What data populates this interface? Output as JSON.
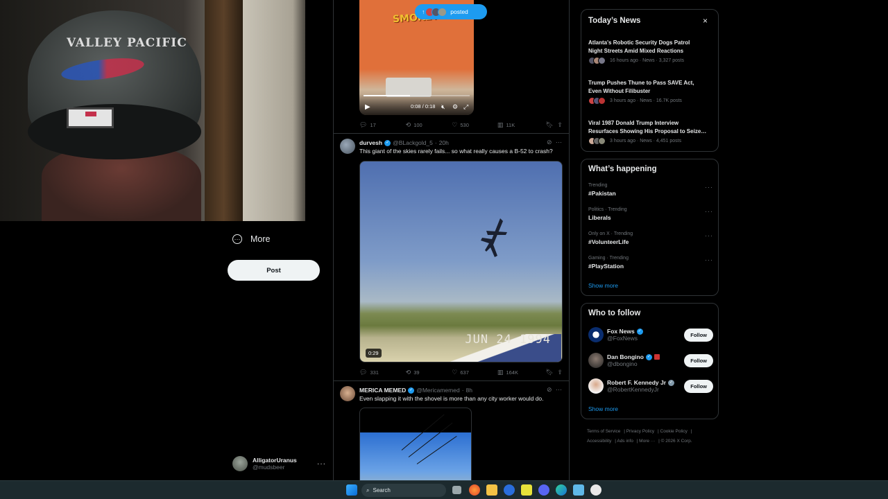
{
  "left_nav": {
    "more_label": "More",
    "post_label": "Post",
    "account": {
      "name": "AlligatorUranus",
      "handle": "@mudsbeer"
    }
  },
  "feed": {
    "new_posts_pill": {
      "label": "posted"
    },
    "tweet1": {
      "video_overlay_text": "SMOKEY",
      "video_time": "0:08 / 0:18",
      "video_progress": 0.44,
      "replies": "17",
      "reposts": "100",
      "likes": "530",
      "views": "11K"
    },
    "tweet2": {
      "name": "durvesh",
      "handle": "@BLackgold_5",
      "time": "20h",
      "text": "This giant of the skies rarely fails... so what really causes a B-52 to crash?",
      "video_duration": "0:29",
      "video_datestamp": "JUN 24 1994",
      "replies": "331",
      "reposts": "39",
      "likes": "637",
      "views": "164K"
    },
    "tweet3": {
      "name": "MERICA MEMED",
      "handle": "@Mericamemed",
      "time": "8h",
      "text": "Even slapping it with the shovel is more than any city worker would do."
    }
  },
  "todays_news": {
    "title": "Today’s News",
    "items": [
      {
        "line1": "Atlanta's Robotic Security Dogs Patrol",
        "line2": "Night Streets Amid Mixed Reactions",
        "meta": "16 hours ago · News · 3,327 posts"
      },
      {
        "line1": "Trump Pushes Thune to Pass SAVE Act,",
        "line2": "Even Without Filibuster",
        "meta": "3 hours ago · News · 16.7K posts"
      },
      {
        "line1": "Viral 1987 Donald Trump Interview",
        "line2": "Resurfaces Showing His Proposal to Seize…",
        "meta": "3 hours ago · News · 4,451 posts"
      }
    ]
  },
  "whats_happening": {
    "title": "What’s happening",
    "trends": [
      {
        "category": "Trending",
        "tag": "#Pakistan"
      },
      {
        "category": "Politics · Trending",
        "tag": "Liberals"
      },
      {
        "category": "Only on X · Trending",
        "tag": "#VolunteerLife"
      },
      {
        "category": "Gaming · Trending",
        "tag": "#PlayStation"
      }
    ],
    "show_more": "Show more"
  },
  "who_to_follow": {
    "title": "Who to follow",
    "accounts": [
      {
        "name": "Fox News",
        "handle": "@FoxNews",
        "follow": "Follow"
      },
      {
        "name": "Dan Bongino",
        "handle": "@dbongino",
        "follow": "Follow"
      },
      {
        "name": "Robert F. Kennedy Jr",
        "handle": "@RobertKennedyJr",
        "follow": "Follow"
      }
    ],
    "show_more": "Show more"
  },
  "footer": {
    "terms": "Terms of Service",
    "privacy": "Privacy Policy",
    "cookie": "Cookie Policy",
    "accessibility": "Accessibility",
    "ads": "Ads info",
    "more": "More ···",
    "copyright": "© 2026 X Corp."
  },
  "taskbar": {
    "search_placeholder": "Search"
  },
  "colors": {
    "accent": "#1d9bf0",
    "background": "#000000",
    "border": "#2f3336",
    "muted": "#71767b"
  }
}
